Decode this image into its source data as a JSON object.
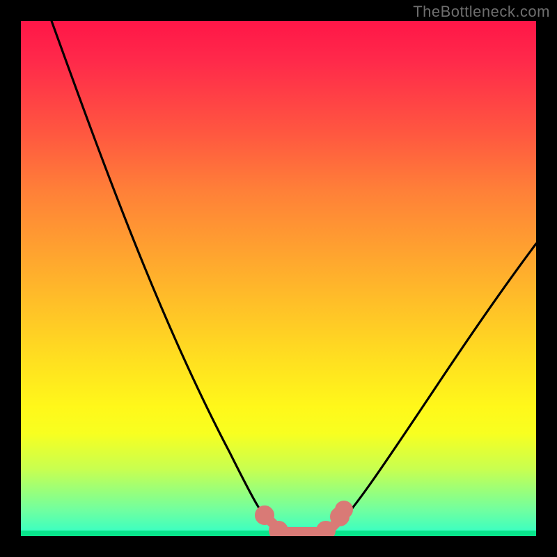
{
  "branding": {
    "text": "TheBottleneck.com"
  },
  "chart_data": {
    "type": "line",
    "title": "",
    "xlabel": "",
    "ylabel": "",
    "xlim": [
      0,
      100
    ],
    "ylim": [
      0,
      100
    ],
    "series": [
      {
        "name": "bottleneck-curve",
        "x": [
          6,
          10,
          15,
          20,
          25,
          30,
          35,
          40,
          45,
          48,
          50,
          52,
          55,
          58,
          60,
          65,
          70,
          75,
          80,
          85,
          90,
          95,
          100
        ],
        "values": [
          100,
          90,
          78,
          66,
          55,
          44,
          33,
          23,
          12,
          5,
          1,
          0,
          0,
          0,
          1,
          5,
          11,
          18,
          25,
          32,
          40,
          47,
          55
        ]
      }
    ],
    "highlight": {
      "name": "minimum-marker",
      "color": "#d97a76",
      "x": [
        47,
        49,
        51,
        53,
        55,
        57,
        59,
        61
      ],
      "values": [
        4,
        1,
        0,
        0,
        0,
        0,
        1,
        4
      ]
    }
  },
  "colors": {
    "curve": "#000000",
    "highlight": "#d97a76"
  }
}
